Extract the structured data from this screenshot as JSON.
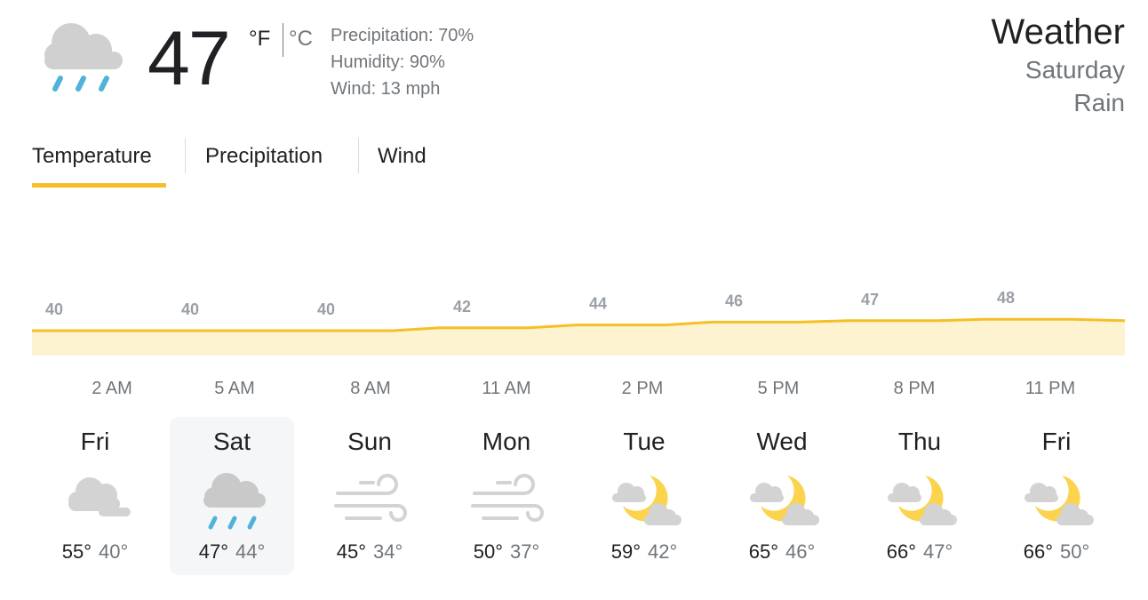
{
  "current": {
    "icon": "rain-icon",
    "temperature": "47",
    "unit_f": "°F",
    "unit_c": "°C",
    "precipitation": "Precipitation: 70%",
    "humidity": "Humidity: 90%",
    "wind": "Wind: 13 mph"
  },
  "header": {
    "title": "Weather",
    "day": "Saturday",
    "condition": "Rain"
  },
  "tabs": [
    {
      "label": "Temperature",
      "selected": true
    },
    {
      "label": "Precipitation",
      "selected": false
    },
    {
      "label": "Wind",
      "selected": false
    }
  ],
  "colors": {
    "accent": "#f6bf26",
    "area_fill": "#fef3d1",
    "rain": "#4fb3d9",
    "sun": "#fcd34d",
    "cloud": "#d0d0d0"
  },
  "chart_data": {
    "type": "area",
    "x": [
      "2 AM",
      "5 AM",
      "8 AM",
      "11 AM",
      "2 PM",
      "5 PM",
      "8 PM",
      "11 PM"
    ],
    "values": [
      40,
      40,
      40,
      42,
      44,
      46,
      47,
      48
    ],
    "end_value": 47
  },
  "days": [
    {
      "name": "Fri",
      "icon": "cloudy-icon",
      "high": "55°",
      "low": "40°",
      "selected": false
    },
    {
      "name": "Sat",
      "icon": "rain-icon",
      "high": "47°",
      "low": "44°",
      "selected": true
    },
    {
      "name": "Sun",
      "icon": "wind-icon",
      "high": "45°",
      "low": "34°",
      "selected": false
    },
    {
      "name": "Mon",
      "icon": "wind-icon",
      "high": "50°",
      "low": "37°",
      "selected": false
    },
    {
      "name": "Tue",
      "icon": "partly-cloudy-night-icon",
      "high": "59°",
      "low": "42°",
      "selected": false
    },
    {
      "name": "Wed",
      "icon": "partly-cloudy-night-icon",
      "high": "65°",
      "low": "46°",
      "selected": false
    },
    {
      "name": "Thu",
      "icon": "partly-cloudy-night-icon",
      "high": "66°",
      "low": "47°",
      "selected": false
    },
    {
      "name": "Fri",
      "icon": "partly-cloudy-night-icon",
      "high": "66°",
      "low": "50°",
      "selected": false
    }
  ]
}
